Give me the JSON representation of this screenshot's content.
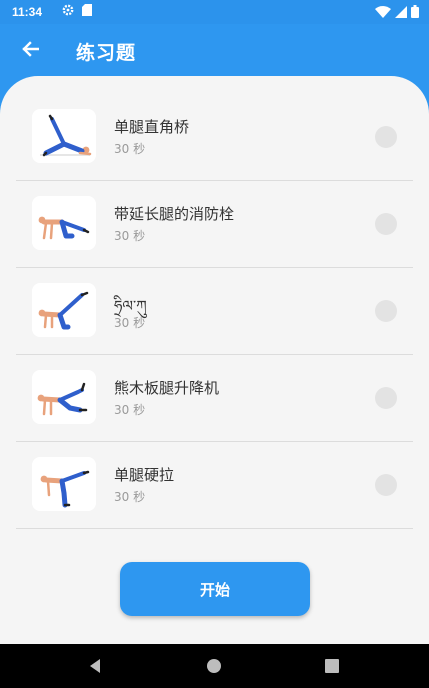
{
  "status_bar": {
    "time": "11:34",
    "icons": [
      "settings-icon",
      "sd-card-icon",
      "wifi-icon",
      "signal-icon",
      "battery-icon"
    ]
  },
  "app_bar": {
    "title": "练习题",
    "back_icon": "arrow-back-icon"
  },
  "exercises": [
    {
      "name": "单腿直角桥",
      "duration": "30 秒",
      "thumbnail": "single-leg-bridge"
    },
    {
      "name": "带延长腿的消防栓",
      "duration": "30 秒",
      "thumbnail": "fire-hydrant-leg-extension"
    },
    {
      "name": "ཧྲིལ་ཀུ",
      "duration": "30 秒",
      "thumbnail": "donkey-kick"
    },
    {
      "name": "熊木板腿升降机",
      "duration": "30 秒",
      "thumbnail": "bear-plank-leg-lift"
    },
    {
      "name": "单腿硬拉",
      "duration": "30 秒",
      "thumbnail": "single-leg-deadlift"
    }
  ],
  "start_button": {
    "label": "开始"
  },
  "nav_bar": {
    "icons": [
      "nav-back-icon",
      "nav-home-icon",
      "nav-recents-icon"
    ]
  },
  "colors": {
    "primary": "#2e97f0",
    "background": "#f5f5f5",
    "check_circle": "#e3e3e3",
    "divider": "#dcdcdc",
    "figure_outfit": "#2f5fcc",
    "figure_skin": "#e8a27c"
  }
}
